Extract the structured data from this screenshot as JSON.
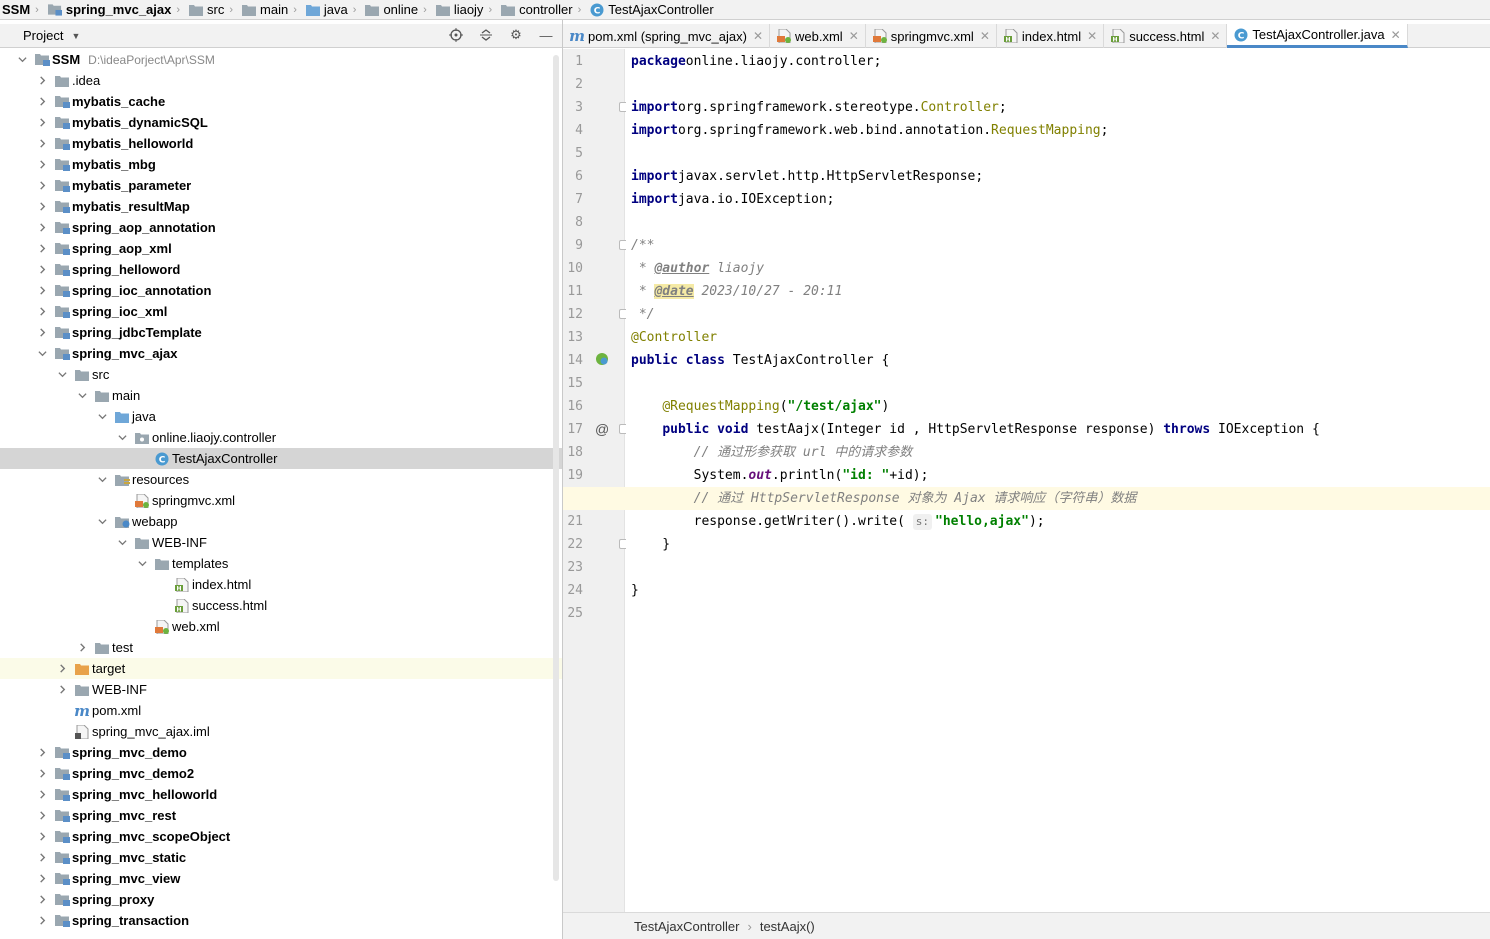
{
  "breadcrumb": [
    "SSM",
    "spring_mvc_ajax",
    "src",
    "main",
    "java",
    "online",
    "liaojy",
    "controller",
    "TestAjaxController"
  ],
  "project_panel": {
    "title": "Project",
    "tree": [
      {
        "label": "SSM",
        "sub": "D:\\ideaPorject\\Apr\\SSM",
        "depth": 0,
        "expanded": true,
        "icon": "module-folder-icon",
        "bold": true
      },
      {
        "label": ".idea",
        "depth": 1,
        "expanded": false,
        "icon": "folder-icon"
      },
      {
        "label": "mybatis_cache",
        "depth": 1,
        "expanded": false,
        "icon": "module-folder-icon",
        "bold": true
      },
      {
        "label": "mybatis_dynamicSQL",
        "depth": 1,
        "expanded": false,
        "icon": "module-folder-icon",
        "bold": true
      },
      {
        "label": "mybatis_helloworld",
        "depth": 1,
        "expanded": false,
        "icon": "module-folder-icon",
        "bold": true
      },
      {
        "label": "mybatis_mbg",
        "depth": 1,
        "expanded": false,
        "icon": "module-folder-icon",
        "bold": true
      },
      {
        "label": "mybatis_parameter",
        "depth": 1,
        "expanded": false,
        "icon": "module-folder-icon",
        "bold": true
      },
      {
        "label": "mybatis_resultMap",
        "depth": 1,
        "expanded": false,
        "icon": "module-folder-icon",
        "bold": true
      },
      {
        "label": "spring_aop_annotation",
        "depth": 1,
        "expanded": false,
        "icon": "module-folder-icon",
        "bold": true
      },
      {
        "label": "spring_aop_xml",
        "depth": 1,
        "expanded": false,
        "icon": "module-folder-icon",
        "bold": true
      },
      {
        "label": "spring_helloword",
        "depth": 1,
        "expanded": false,
        "icon": "module-folder-icon",
        "bold": true
      },
      {
        "label": "spring_ioc_annotation",
        "depth": 1,
        "expanded": false,
        "icon": "module-folder-icon",
        "bold": true
      },
      {
        "label": "spring_ioc_xml",
        "depth": 1,
        "expanded": false,
        "icon": "module-folder-icon",
        "bold": true
      },
      {
        "label": "spring_jdbcTemplate",
        "depth": 1,
        "expanded": false,
        "icon": "module-folder-icon",
        "bold": true
      },
      {
        "label": "spring_mvc_ajax",
        "depth": 1,
        "expanded": true,
        "icon": "module-folder-icon",
        "bold": true
      },
      {
        "label": "src",
        "depth": 2,
        "expanded": true,
        "icon": "folder-icon"
      },
      {
        "label": "main",
        "depth": 3,
        "expanded": true,
        "icon": "folder-icon"
      },
      {
        "label": "java",
        "depth": 4,
        "expanded": true,
        "icon": "source-folder-icon"
      },
      {
        "label": "online.liaojy.controller",
        "depth": 5,
        "expanded": true,
        "icon": "package-icon"
      },
      {
        "label": "TestAjaxController",
        "depth": 6,
        "leaf": true,
        "icon": "class-icon",
        "selected": true
      },
      {
        "label": "resources",
        "depth": 4,
        "expanded": true,
        "icon": "resources-folder-icon"
      },
      {
        "label": "springmvc.xml",
        "depth": 5,
        "leaf": true,
        "icon": "spring-xml-icon"
      },
      {
        "label": "webapp",
        "depth": 4,
        "expanded": true,
        "icon": "web-folder-icon"
      },
      {
        "label": "WEB-INF",
        "depth": 5,
        "expanded": true,
        "icon": "folder-icon"
      },
      {
        "label": "templates",
        "depth": 6,
        "expanded": true,
        "icon": "folder-icon"
      },
      {
        "label": "index.html",
        "depth": 7,
        "leaf": true,
        "icon": "html-file-icon"
      },
      {
        "label": "success.html",
        "depth": 7,
        "leaf": true,
        "icon": "html-file-icon"
      },
      {
        "label": "web.xml",
        "depth": 6,
        "leaf": true,
        "icon": "web-xml-icon"
      },
      {
        "label": "test",
        "depth": 3,
        "expanded": false,
        "icon": "folder-icon"
      },
      {
        "label": "target",
        "depth": 2,
        "expanded": false,
        "icon": "excluded-folder-icon",
        "highlight": true
      },
      {
        "label": "WEB-INF",
        "depth": 2,
        "expanded": false,
        "icon": "folder-icon"
      },
      {
        "label": "pom.xml",
        "depth": 2,
        "leaf": true,
        "icon": "maven-icon"
      },
      {
        "label": "spring_mvc_ajax.iml",
        "depth": 2,
        "leaf": true,
        "icon": "iml-file-icon"
      },
      {
        "label": "spring_mvc_demo",
        "depth": 1,
        "expanded": false,
        "icon": "module-folder-icon",
        "bold": true
      },
      {
        "label": "spring_mvc_demo2",
        "depth": 1,
        "expanded": false,
        "icon": "module-folder-icon",
        "bold": true
      },
      {
        "label": "spring_mvc_helloworld",
        "depth": 1,
        "expanded": false,
        "icon": "module-folder-icon",
        "bold": true
      },
      {
        "label": "spring_mvc_rest",
        "depth": 1,
        "expanded": false,
        "icon": "module-folder-icon",
        "bold": true
      },
      {
        "label": "spring_mvc_scopeObject",
        "depth": 1,
        "expanded": false,
        "icon": "module-folder-icon",
        "bold": true
      },
      {
        "label": "spring_mvc_static",
        "depth": 1,
        "expanded": false,
        "icon": "module-folder-icon",
        "bold": true
      },
      {
        "label": "spring_mvc_view",
        "depth": 1,
        "expanded": false,
        "icon": "module-folder-icon",
        "bold": true
      },
      {
        "label": "spring_proxy",
        "depth": 1,
        "expanded": false,
        "icon": "module-folder-icon",
        "bold": true
      },
      {
        "label": "spring_transaction",
        "depth": 1,
        "expanded": false,
        "icon": "module-folder-icon",
        "bold": true
      }
    ]
  },
  "editor_tabs": [
    {
      "label": "pom.xml (spring_mvc_ajax)",
      "icon": "maven-icon",
      "active": false
    },
    {
      "label": "web.xml",
      "icon": "web-xml-icon",
      "active": false
    },
    {
      "label": "springmvc.xml",
      "icon": "spring-xml-icon",
      "active": false
    },
    {
      "label": "index.html",
      "icon": "html-file-icon",
      "active": false
    },
    {
      "label": "success.html",
      "icon": "html-file-icon",
      "active": false
    },
    {
      "label": "TestAjaxController.java",
      "icon": "class-icon",
      "active": true
    }
  ],
  "code_lines": [
    [
      [
        "kw",
        "package"
      ],
      [
        "",
        "online.liaojy.controller;"
      ]
    ],
    [],
    [
      [
        "kw",
        "import"
      ],
      [
        "",
        "org.springframework.stereotype."
      ],
      [
        "ann",
        "Controller"
      ],
      [
        "",
        ";"
      ]
    ],
    [
      [
        "kw",
        "import"
      ],
      [
        "",
        "org.springframework.web.bind.annotation."
      ],
      [
        "ann",
        "RequestMapping"
      ],
      [
        "",
        ";"
      ]
    ],
    [],
    [
      [
        "kw",
        "import"
      ],
      [
        "",
        "javax.servlet.http.HttpServletResponse;"
      ]
    ],
    [
      [
        "kw",
        "import"
      ],
      [
        "",
        "java.io.IOException;"
      ]
    ],
    [],
    [
      [
        "cmt",
        "/**"
      ]
    ],
    [
      [
        "cmt",
        " * "
      ],
      [
        "tag",
        "@author"
      ],
      [
        "cmt",
        " liaojy"
      ]
    ],
    [
      [
        "cmt",
        " * "
      ],
      [
        "tag hlx",
        "@date"
      ],
      [
        "cmt",
        " 2023/10/27 - 20:11"
      ]
    ],
    [
      [
        "cmt",
        " */"
      ]
    ],
    [
      [
        "ann",
        "@Controller"
      ]
    ],
    [
      [
        "kw",
        "public class"
      ],
      [
        "",
        " TestAjaxController {"
      ]
    ],
    [],
    [
      [
        "",
        "    "
      ],
      [
        "ann",
        "@RequestMapping"
      ],
      [
        "",
        "("
      ],
      [
        "str",
        "\"/test/ajax\""
      ],
      [
        "",
        ")"
      ]
    ],
    [
      [
        "",
        "    "
      ],
      [
        "kw",
        "public void"
      ],
      [
        "",
        " testAajx(Integer id , HttpServletResponse response) "
      ],
      [
        "kw",
        "throws"
      ],
      [
        "",
        " IOException {"
      ]
    ],
    [
      [
        "",
        "        "
      ],
      [
        "cmt",
        "// 通过形参获取 url 中的请求参数"
      ]
    ],
    [
      [
        "",
        "        System."
      ],
      [
        "fld",
        "out"
      ],
      [
        "",
        ".println("
      ],
      [
        "str",
        "\"id: \""
      ],
      [
        "",
        "+id);"
      ]
    ],
    [
      [
        "",
        "        "
      ],
      [
        "cmt",
        "// 通过 HttpServletResponse 对象为 Ajax 请求响应（字符串）数据"
      ]
    ],
    [
      [
        "",
        "        response.getWriter().write( "
      ],
      [
        "hint",
        "s:"
      ],
      [
        "str",
        "\"hello,ajax\""
      ],
      [
        "",
        ");"
      ]
    ],
    [
      [
        "",
        "    }"
      ]
    ],
    [],
    [
      [
        "",
        "}"
      ]
    ],
    []
  ],
  "current_line": 20,
  "gutter_marks": [
    {
      "line": 14,
      "icon": "spring-bean-icon"
    },
    {
      "line": 17,
      "icon": "at-icon"
    }
  ],
  "fold_lines": [
    3,
    9,
    12,
    17,
    22
  ],
  "footer": {
    "class_name": "TestAjaxController",
    "method_name": "testAajx()"
  }
}
